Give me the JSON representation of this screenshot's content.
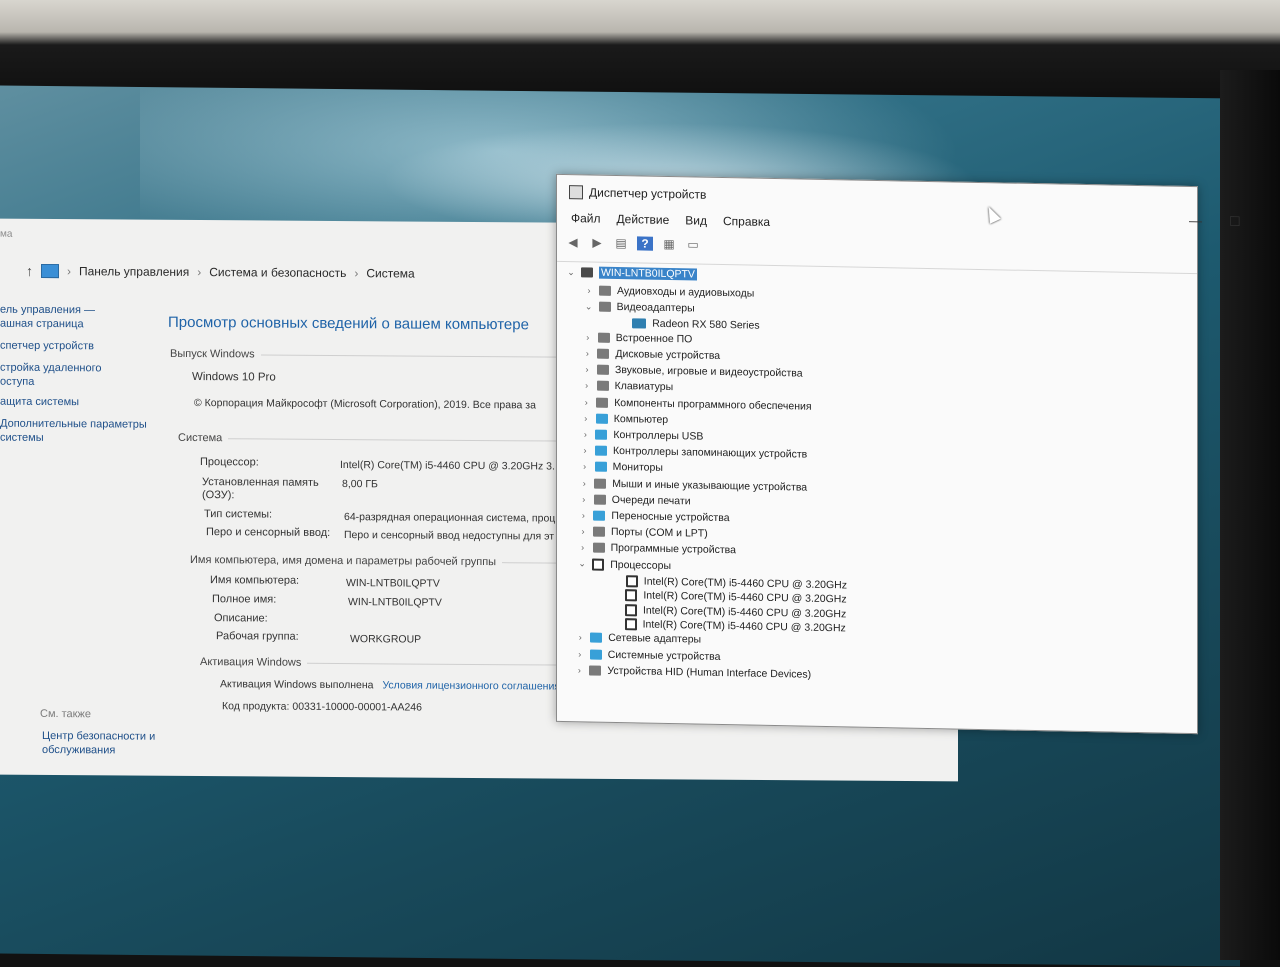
{
  "system_window": {
    "title_fragment": "ма",
    "breadcrumb": [
      "Панель управления",
      "Система и безопасность",
      "Система"
    ],
    "sidebar": {
      "home": [
        "ель управления —",
        "ашная страница"
      ],
      "links": [
        "спетчер устройств",
        "стройка удаленного",
        "оступа",
        "ащита системы",
        "Дополнительные параметры",
        "системы"
      ],
      "see_also": "См. также",
      "security_link": "Центр безопасности и обслуживания"
    },
    "heading": "Просмотр основных сведений о вашем компьютере",
    "edition_section": "Выпуск Windows",
    "edition": "Windows 10 Pro",
    "copyright": "© Корпорация Майкрософт (Microsoft Corporation), 2019. Все права за",
    "system_section": "Система",
    "rows": [
      {
        "label": "Процессор:",
        "value": "Intel(R) Core(TM) i5-4460  CPU @ 3.20GHz   3."
      },
      {
        "label": "Установленная память (ОЗУ):",
        "value": "8,00 ГБ"
      },
      {
        "label": "Тип системы:",
        "value": "64-разрядная операционная система, проц"
      },
      {
        "label": "Перо и сенсорный ввод:",
        "value": "Перо и сенсорный ввод недоступны для эт"
      }
    ],
    "name_section": "Имя компьютера, имя домена и параметры рабочей группы",
    "name_rows": [
      {
        "label": "Имя компьютера:",
        "value": "WIN-LNTB0ILQPTV"
      },
      {
        "label": "Полное имя:",
        "value": "WIN-LNTB0ILQPTV"
      },
      {
        "label": "Описание:",
        "value": ""
      },
      {
        "label": "Рабочая группа:",
        "value": "WORKGROUP"
      }
    ],
    "activation_section": "Активация Windows",
    "activation_status": "Активация Windows выполнена",
    "license_link": "Условия лицензионного соглашения",
    "product_key_label": "Код продукта:",
    "product_key": "00331-10000-00001-AA246"
  },
  "device_manager": {
    "title": "Диспетчер устройств",
    "menu": [
      "Файл",
      "Действие",
      "Вид",
      "Справка"
    ],
    "controls": [
      "—",
      "☐",
      "✕"
    ],
    "root": "WIN-LNTB0ILQPTV",
    "nodes": [
      {
        "label": "Аудиовходы и аудиовыходы",
        "exp": "›",
        "icon": "speaker-icon"
      },
      {
        "label": "Видеоадаптеры",
        "exp": "⌄",
        "icon": "display-adapter-icon"
      },
      {
        "label": "Radeon RX 580 Series",
        "exp": "",
        "icon": "gpu-icon",
        "child": true
      },
      {
        "label": "Встроенное ПО",
        "exp": "›",
        "icon": "firmware-icon"
      },
      {
        "label": "Дисковые устройства",
        "exp": "›",
        "icon": "disk-icon"
      },
      {
        "label": "Звуковые, игровые и видеоустройства",
        "exp": "›",
        "icon": "sound-icon"
      },
      {
        "label": "Клавиатуры",
        "exp": "›",
        "icon": "keyboard-icon"
      },
      {
        "label": "Компоненты программного обеспечения",
        "exp": "›",
        "icon": "software-icon"
      },
      {
        "label": "Компьютер",
        "exp": "›",
        "icon": "computer-icon"
      },
      {
        "label": "Контроллеры USB",
        "exp": "›",
        "icon": "usb-icon"
      },
      {
        "label": "Контроллеры запоминающих устройств",
        "exp": "›",
        "icon": "storage-icon"
      },
      {
        "label": "Мониторы",
        "exp": "›",
        "icon": "monitor-icon"
      },
      {
        "label": "Мыши и иные указывающие устройства",
        "exp": "›",
        "icon": "mouse-icon"
      },
      {
        "label": "Очереди печати",
        "exp": "›",
        "icon": "printer-icon"
      },
      {
        "label": "Переносные устройства",
        "exp": "›",
        "icon": "portable-icon"
      },
      {
        "label": "Порты (COM и LPT)",
        "exp": "›",
        "icon": "port-icon"
      },
      {
        "label": "Программные устройства",
        "exp": "›",
        "icon": "software-device-icon"
      },
      {
        "label": "Процессоры",
        "exp": "⌄",
        "icon": "processor-icon"
      },
      {
        "label": "Intel(R) Core(TM) i5-4460  CPU @ 3.20GHz",
        "exp": "",
        "icon": "cpu-icon",
        "child": true
      },
      {
        "label": "Intel(R) Core(TM) i5-4460  CPU @ 3.20GHz",
        "exp": "",
        "icon": "cpu-icon",
        "child": true
      },
      {
        "label": "Intel(R) Core(TM) i5-4460  CPU @ 3.20GHz",
        "exp": "",
        "icon": "cpu-icon",
        "child": true
      },
      {
        "label": "Intel(R) Core(TM) i5-4460  CPU @ 3.20GHz",
        "exp": "",
        "icon": "cpu-icon",
        "child": true
      },
      {
        "label": "Сетевые адаптеры",
        "exp": "›",
        "icon": "network-icon"
      },
      {
        "label": "Системные устройства",
        "exp": "›",
        "icon": "system-device-icon"
      },
      {
        "label": "Устройства HID (Human Interface Devices)",
        "exp": "›",
        "icon": "hid-icon"
      }
    ]
  }
}
